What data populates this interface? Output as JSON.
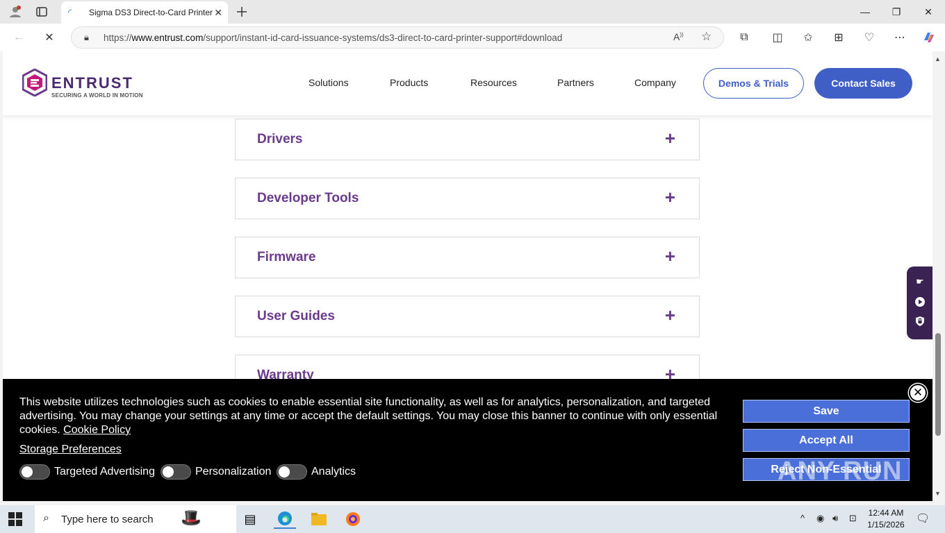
{
  "browser": {
    "tab_title": "Sigma DS3 Direct-to-Card Printer",
    "url_prefix": "https://",
    "url_host": "www.entrust.com",
    "url_path": "/support/instant-id-card-issuance-systems/ds3-direct-to-card-printer-support#download"
  },
  "header": {
    "brand": "ENTRUST",
    "tagline": "SECURING A WORLD IN MOTION",
    "menu": [
      "Solutions",
      "Products",
      "Resources",
      "Partners",
      "Company"
    ],
    "demos_label": "Demos & Trials",
    "contact_label": "Contact Sales"
  },
  "accordion": [
    {
      "label": "Drivers"
    },
    {
      "label": "Developer Tools"
    },
    {
      "label": "Firmware"
    },
    {
      "label": "User Guides"
    },
    {
      "label": "Warranty"
    }
  ],
  "cookie": {
    "text": "This website utilizes technologies such as cookies to enable essential site functionality, as well as for analytics, personalization, and targeted advertising. You may change your settings at any time or accept the default settings. You may close this banner to continue with only essential cookies.",
    "policy_link": "Cookie Policy",
    "storage_preferences": "Storage Preferences",
    "toggles": [
      {
        "label": "Targeted Advertising",
        "on": false
      },
      {
        "label": "Personalization",
        "on": false
      },
      {
        "label": "Analytics",
        "on": false
      }
    ],
    "save_label": "Save",
    "accept_label": "Accept All",
    "reject_label": "Reject Non-Essential",
    "watermark": "ANY RUN"
  },
  "taskbar": {
    "search_placeholder": "Type here to search",
    "time": "12:44 AM",
    "date": "1/15/2026"
  },
  "colors": {
    "brand_purple": "#6a3a8c",
    "button_blue": "#3f5fc7"
  }
}
